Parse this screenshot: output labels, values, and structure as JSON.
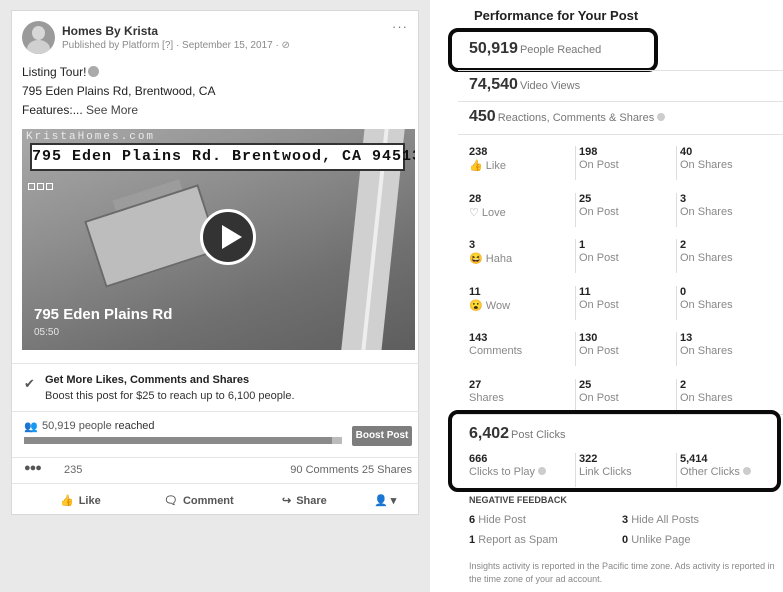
{
  "post": {
    "page_name": "Homes By Krista",
    "meta": "Published by Platform [?] · September 15, 2017 · ⊘",
    "more": "···",
    "line1": "Listing Tour!",
    "line2": "795 Eden Plains Rd, Brentwood, CA",
    "line3": "Features:... ",
    "see_more": "See More",
    "video": {
      "watermark": "KristaHomes.com",
      "banner": "795 Eden Plains Rd. Brentwood, CA 94513",
      "title": "795 Eden Plains Rd",
      "duration": "05:50"
    },
    "promo": {
      "title": "Get More Likes, Comments and Shares",
      "subtitle": "Boost this post for $25 to reach up to 6,100 people."
    },
    "reach": {
      "count": "50,919 people",
      "suffix": " reached",
      "fill_fraction": 0.97,
      "boost_label": "Boost Post"
    },
    "reactions": {
      "count": "235",
      "comments": "90 Comments",
      "shares": "25 Shares"
    },
    "actions": {
      "like": "Like",
      "comment": "Comment",
      "share": "Share"
    }
  },
  "performance": {
    "title": "Performance for Your Post",
    "people_reached": {
      "value": "50,919",
      "label": "People Reached"
    },
    "video_views": {
      "value": "74,540",
      "label": "Video Views"
    },
    "reactions_total": {
      "value": "450",
      "label": "Reactions, Comments & Shares"
    },
    "breakdown": [
      {
        "total": "238",
        "label": "Like",
        "icon": "like-icon",
        "on_post": "198",
        "on_shares": "40"
      },
      {
        "total": "28",
        "label": "Love",
        "icon": "love-icon",
        "on_post": "25",
        "on_shares": "3"
      },
      {
        "total": "3",
        "label": "Haha",
        "icon": "haha-icon",
        "on_post": "1",
        "on_shares": "2"
      },
      {
        "total": "11",
        "label": "Wow",
        "icon": "wow-icon",
        "on_post": "11",
        "on_shares": "0"
      },
      {
        "total": "143",
        "label": "Comments",
        "icon": "",
        "on_post": "130",
        "on_shares": "13"
      },
      {
        "total": "27",
        "label": "Shares",
        "icon": "",
        "on_post": "25",
        "on_shares": "2"
      }
    ],
    "on_post_label": "On Post",
    "on_shares_label": "On Shares",
    "post_clicks": {
      "value": "6,402",
      "label": "Post Clicks"
    },
    "clicks": [
      {
        "value": "666",
        "label": "Clicks to Play"
      },
      {
        "value": "322",
        "label": "Link Clicks"
      },
      {
        "value": "5,414",
        "label": "Other Clicks"
      }
    ],
    "negative": {
      "title": "NEGATIVE FEEDBACK",
      "hide_post": {
        "value": "6",
        "label": "Hide Post"
      },
      "hide_all": {
        "value": "3",
        "label": "Hide All Posts"
      },
      "spam": {
        "value": "1",
        "label": "Report as Spam"
      },
      "unlike": {
        "value": "0",
        "label": "Unlike Page"
      }
    },
    "footnote": "Insights activity is reported in the Pacific time zone. Ads activity is reported in the time zone of your ad account."
  }
}
